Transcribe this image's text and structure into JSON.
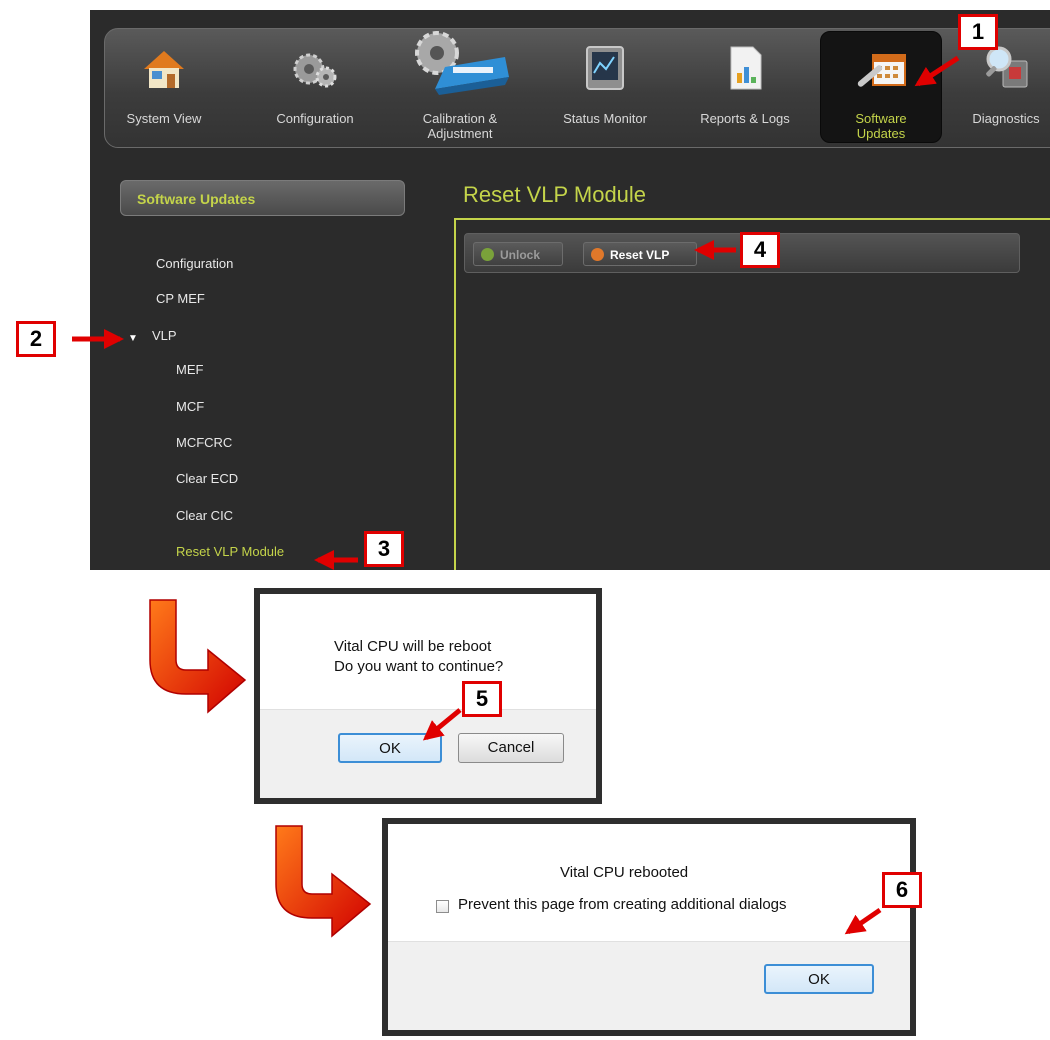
{
  "toolbar": {
    "items": [
      {
        "label": "System View"
      },
      {
        "label": "Configuration"
      },
      {
        "label": "Calibration & Adjustment"
      },
      {
        "label": "Status Monitor"
      },
      {
        "label": "Reports & Logs"
      },
      {
        "label": "Software Updates",
        "active": true
      },
      {
        "label": "Diagnostics"
      }
    ]
  },
  "sidebar": {
    "header": "Software Updates",
    "items": [
      {
        "label": "Configuration"
      },
      {
        "label": "CP MEF"
      },
      {
        "label": "VLP"
      },
      {
        "label": "MEF"
      },
      {
        "label": "MCF"
      },
      {
        "label": "MCFCRC"
      },
      {
        "label": "Clear ECD"
      },
      {
        "label": "Clear CIC"
      },
      {
        "label": "Reset VLP Module"
      }
    ]
  },
  "content": {
    "title": "Reset VLP Module",
    "unlock_label": "Unlock",
    "reset_label": "Reset VLP"
  },
  "callouts": [
    "1",
    "2",
    "3",
    "4",
    "5",
    "6"
  ],
  "dialog1": {
    "line1": "Vital CPU will be reboot",
    "line2": "Do you want to continue?",
    "ok_label": "OK",
    "cancel_label": "Cancel"
  },
  "dialog2": {
    "message": "Vital CPU rebooted",
    "checkbox_label": "Prevent this page from creating additional dialogs",
    "ok_label": "OK"
  },
  "colors": {
    "accent": "#c4d44a",
    "callout_red": "#e00000",
    "dialog_default_border": "#3c8ed6"
  }
}
